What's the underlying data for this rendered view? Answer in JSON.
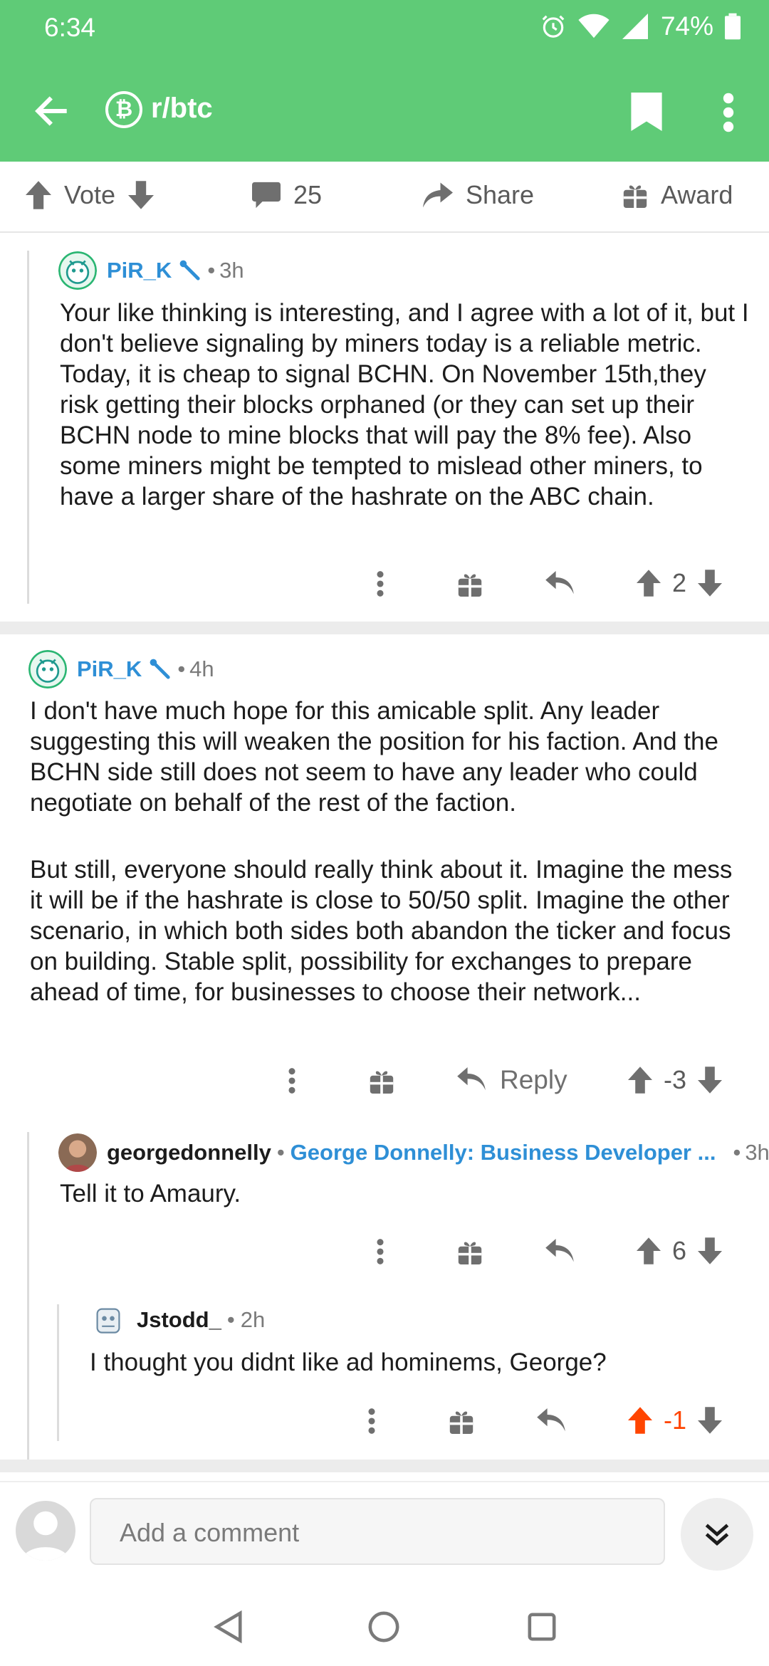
{
  "status_bar": {
    "time": "6:34",
    "battery": "74%"
  },
  "app_bar": {
    "badge_symbol": "₿",
    "subreddit": "r/btc"
  },
  "post_actions": {
    "vote_label": "Vote",
    "comment_count": "25",
    "share_label": "Share",
    "award_label": "Award"
  },
  "comments": [
    {
      "author": "PiR_K",
      "time": "3h",
      "body": "Your like thinking is interesting, and I agree with a lot of it, but I don't believe signaling by miners today is a reliable metric. Today, it is cheap to signal BCHN. On November 15th,they risk getting their blocks orphaned (or they can set up their BCHN node to mine blocks that will pay the 8% fee). Also some miners might be tempted to mislead other miners, to have a larger share of the hashrate on the ABC chain.",
      "score": "2"
    },
    {
      "author": "PiR_K",
      "time": "4h",
      "body_p1": "I don't have much hope for this amicable split. Any leader suggesting this will weaken the position for his faction. And the BCHN side still does not seem to have any leader who could negotiate on behalf of the rest of the faction.",
      "body_p2": "But still, everyone should really think about it. Imagine the mess it will be if the hashrate is close to 50/50 split. Imagine the other scenario, in which both sides both abandon the ticker and focus on building. Stable split, possibility for exchanges to prepare ahead of time, for businesses to choose their network...",
      "reply_label": "Reply",
      "score": "-3"
    },
    {
      "author": "georgedonnelly",
      "flair": "George Donnelly: Business Developer ...",
      "time": "3h",
      "body": "Tell it to Amaury.",
      "score": "6"
    },
    {
      "author": "Jstodd_",
      "time": "2h",
      "body": "I thought you didnt like ad hominems, George?",
      "score": "-1"
    }
  ],
  "compose": {
    "placeholder": "Add a comment"
  },
  "colors": {
    "header_green": "#5fcb77",
    "upvote_orange": "#ff4500",
    "author_blue": "#2e8fd6"
  }
}
